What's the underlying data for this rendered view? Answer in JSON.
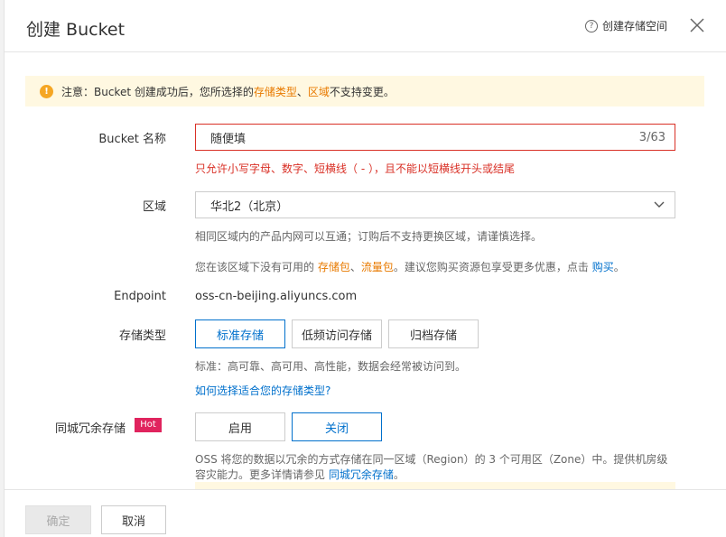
{
  "dialog": {
    "title": "创建 Bucket",
    "help_link": "创建存储空间"
  },
  "notice": {
    "prefix": "注意：Bucket 创建成功后，您所选择的 ",
    "highlight1": "存储类型",
    "sep": "、",
    "highlight2": "区域",
    "suffix": " 不支持变更。"
  },
  "bucket_name": {
    "label": "Bucket 名称",
    "value": "随便填",
    "counter": "3/63",
    "error": "只允许小写字母、数字、短横线（ - ），且不能以短横线开头或结尾"
  },
  "region": {
    "label": "区域",
    "selected": "华北2（北京）",
    "hint": "相同区域内的产品内网可以互通；订购后不支持更换区域，请谨慎选择。",
    "hint2_prefix": "您在该区域下没有可用的 ",
    "hint2_link1": "存储包",
    "hint2_sep": "、",
    "hint2_link2": "流量包",
    "hint2_middle": "。建议您购买资源包享受更多优惠，点击 ",
    "hint2_link3": "购买",
    "hint2_suffix": "。"
  },
  "endpoint": {
    "label": "Endpoint",
    "value": "oss-cn-beijing.aliyuncs.com"
  },
  "storage_class": {
    "label": "存储类型",
    "options": [
      "标准存储",
      "低频访问存储",
      "归档存储"
    ],
    "selected": "标准存储",
    "hint": "标准：高可靠、高可用、高性能，数据会经常被访问到。",
    "link": "如何选择适合您的存储类型?"
  },
  "zrs": {
    "label": "同城冗余存储",
    "badge": "Hot",
    "options": [
      "启用",
      "关闭"
    ],
    "selected": "关闭",
    "hint": "OSS 将您的数据以冗余的方式存储在同一区域（Region）的 3 个可用区（Zone）中。提供机房级",
    "hint2": "容灾能力。更多详情请参见 ",
    "hint2_link": "同城冗余存储",
    "hint2_suffix": "。"
  },
  "footer": {
    "ok": "确定",
    "cancel": "取消"
  },
  "colors": {
    "accent": "#0070cc",
    "warning": "#e87a00",
    "error": "#d93026",
    "hot": "#e0245e"
  }
}
